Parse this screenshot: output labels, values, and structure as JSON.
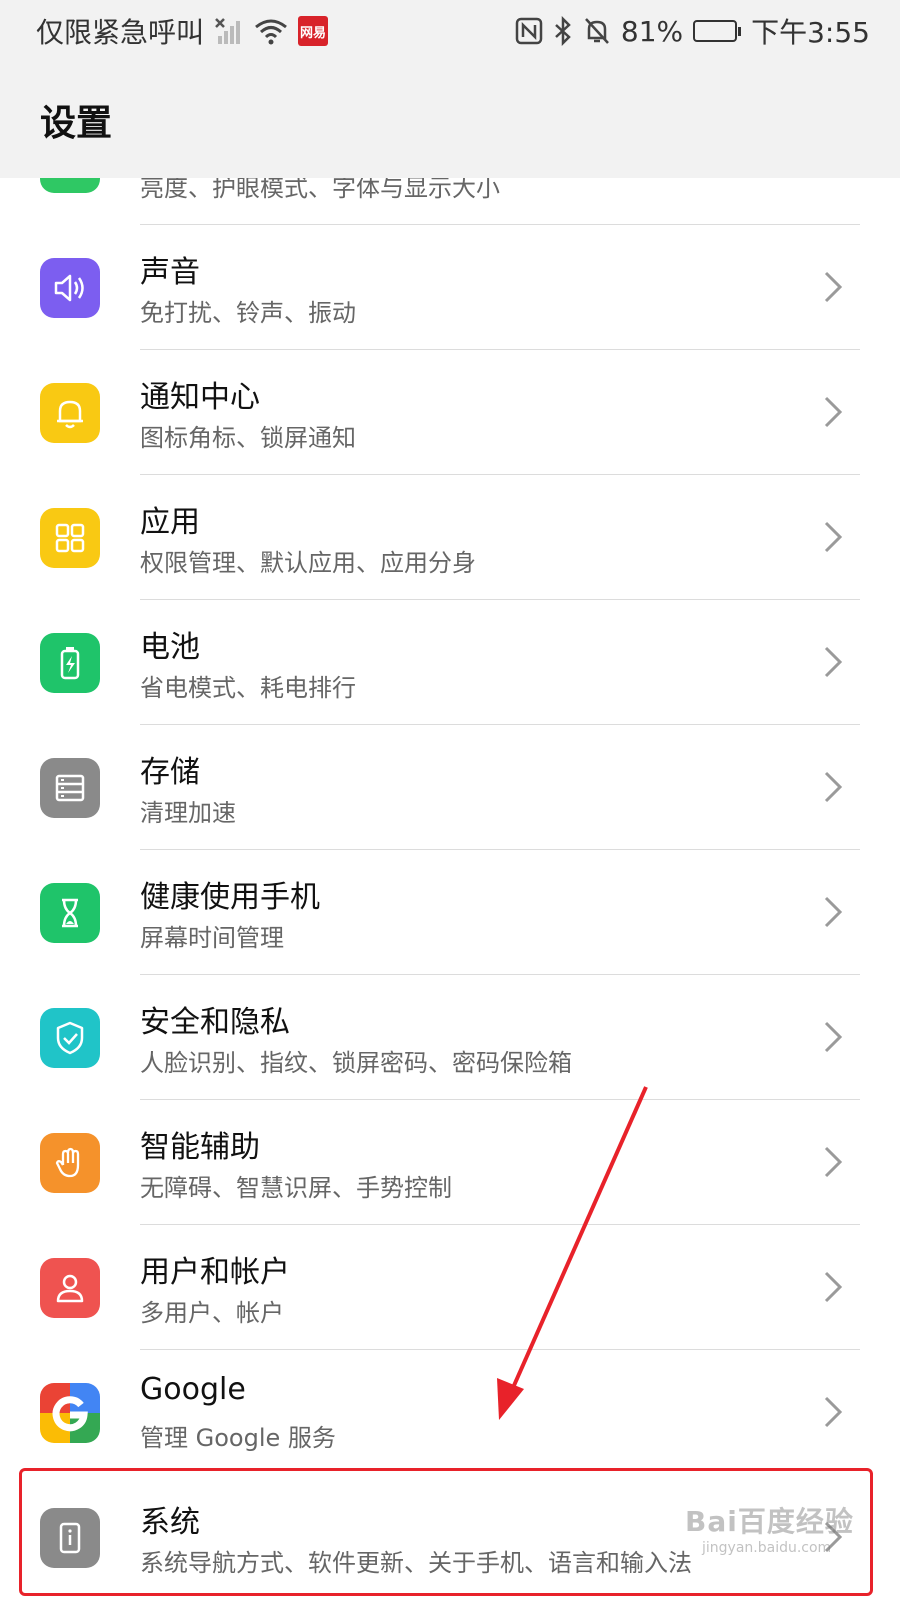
{
  "status_bar": {
    "carrier": "仅限紧急呼叫",
    "news_badge": "网易",
    "battery": "81%",
    "battery_level": 0.81,
    "time": "下午3:55",
    "icons": [
      "no-signal-icon",
      "wifi-icon",
      "nfc-icon",
      "bluetooth-icon",
      "mute-icon",
      "battery-icon"
    ]
  },
  "header": {
    "title": "设置"
  },
  "list": {
    "items": [
      {
        "title": "",
        "subtitle": "亮度、护眼模式、字体与显示大小",
        "icon": "display-icon",
        "color": "#2fc864"
      },
      {
        "title": "声音",
        "subtitle": "免打扰、铃声、振动",
        "icon": "speaker-icon",
        "color": "#7c5ef0"
      },
      {
        "title": "通知中心",
        "subtitle": "图标角标、锁屏通知",
        "icon": "bell-icon",
        "color": "#f9c913"
      },
      {
        "title": "应用",
        "subtitle": "权限管理、默认应用、应用分身",
        "icon": "apps-grid-icon",
        "color": "#f9c913"
      },
      {
        "title": "电池",
        "subtitle": "省电模式、耗电排行",
        "icon": "battery-charging-icon",
        "color": "#1fc46a"
      },
      {
        "title": "存储",
        "subtitle": "清理加速",
        "icon": "storage-icon",
        "color": "#8a8a8a"
      },
      {
        "title": "健康使用手机",
        "subtitle": "屏幕时间管理",
        "icon": "hourglass-icon",
        "color": "#1fc46a"
      },
      {
        "title": "安全和隐私",
        "subtitle": "人脸识别、指纹、锁屏密码、密码保险箱",
        "icon": "shield-icon",
        "color": "#20c4c8"
      },
      {
        "title": "智能辅助",
        "subtitle": "无障碍、智慧识屏、手势控制",
        "icon": "hand-icon",
        "color": "#f5922b"
      },
      {
        "title": "用户和帐户",
        "subtitle": "多用户、帐户",
        "icon": "user-icon",
        "color": "#ef5350"
      },
      {
        "title": "Google",
        "subtitle": "管理 Google 服务",
        "icon": "google-icon",
        "color": "#4285f4"
      },
      {
        "title": "系统",
        "subtitle": "系统导航方式、软件更新、关于手机、语言和输入法",
        "icon": "system-phone-icon",
        "color": "#8a8a8a"
      }
    ]
  },
  "watermark": {
    "text": "Bai百度经验",
    "sub": "jingyan.baidu.com"
  },
  "colors": {
    "highlight": "#e8222a",
    "background": "#ffffff",
    "header_bg": "#f2f2f2"
  }
}
